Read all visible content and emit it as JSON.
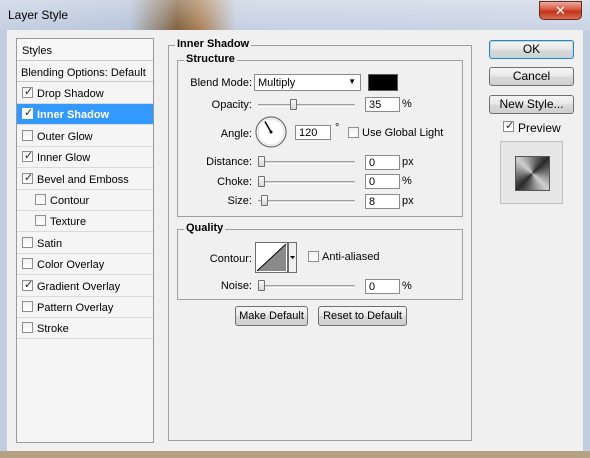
{
  "window": {
    "title": "Layer Style",
    "close_glyph": "✕"
  },
  "styles_panel": {
    "header": "Styles",
    "blending_options": "Blending Options: Default",
    "items": [
      {
        "label": "Drop Shadow",
        "checked": true,
        "selected": false,
        "indent": false
      },
      {
        "label": "Inner Shadow",
        "checked": true,
        "selected": true,
        "indent": false
      },
      {
        "label": "Outer Glow",
        "checked": false,
        "selected": false,
        "indent": false
      },
      {
        "label": "Inner Glow",
        "checked": true,
        "selected": false,
        "indent": false
      },
      {
        "label": "Bevel and Emboss",
        "checked": true,
        "selected": false,
        "indent": false
      },
      {
        "label": "Contour",
        "checked": false,
        "selected": false,
        "indent": true
      },
      {
        "label": "Texture",
        "checked": false,
        "selected": false,
        "indent": true
      },
      {
        "label": "Satin",
        "checked": false,
        "selected": false,
        "indent": false
      },
      {
        "label": "Color Overlay",
        "checked": false,
        "selected": false,
        "indent": false
      },
      {
        "label": "Gradient Overlay",
        "checked": true,
        "selected": false,
        "indent": false
      },
      {
        "label": "Pattern Overlay",
        "checked": false,
        "selected": false,
        "indent": false
      },
      {
        "label": "Stroke",
        "checked": false,
        "selected": false,
        "indent": false
      }
    ]
  },
  "inner_shadow": {
    "title": "Inner Shadow",
    "structure": {
      "title": "Structure",
      "blend_mode_label": "Blend Mode:",
      "blend_mode_value": "Multiply",
      "blend_color": "#000000",
      "opacity_label": "Opacity:",
      "opacity_value": "35",
      "opacity_unit": "%",
      "opacity_level": 0.35,
      "angle_label": "Angle:",
      "angle_value": "120",
      "angle_unit": "°",
      "use_global_light_label": "Use Global Light",
      "use_global_light_checked": false,
      "distance_label": "Distance:",
      "distance_value": "0",
      "distance_unit": "px",
      "distance_level": 0,
      "choke_label": "Choke:",
      "choke_value": "0",
      "choke_unit": "%",
      "choke_level": 0,
      "size_label": "Size:",
      "size_value": "8",
      "size_unit": "px",
      "size_level": 0.03
    },
    "quality": {
      "title": "Quality",
      "contour_label": "Contour:",
      "anti_aliased_label": "Anti-aliased",
      "anti_aliased_checked": false,
      "noise_label": "Noise:",
      "noise_value": "0",
      "noise_unit": "%",
      "noise_level": 0
    },
    "make_default_label": "Make Default",
    "reset_default_label": "Reset to Default"
  },
  "buttons": {
    "ok": "OK",
    "cancel": "Cancel",
    "new_style": "New Style..."
  },
  "preview": {
    "label": "Preview",
    "checked": true
  },
  "colors": {
    "selection": "#3399ff",
    "ok_border": "#3c7fb1"
  }
}
